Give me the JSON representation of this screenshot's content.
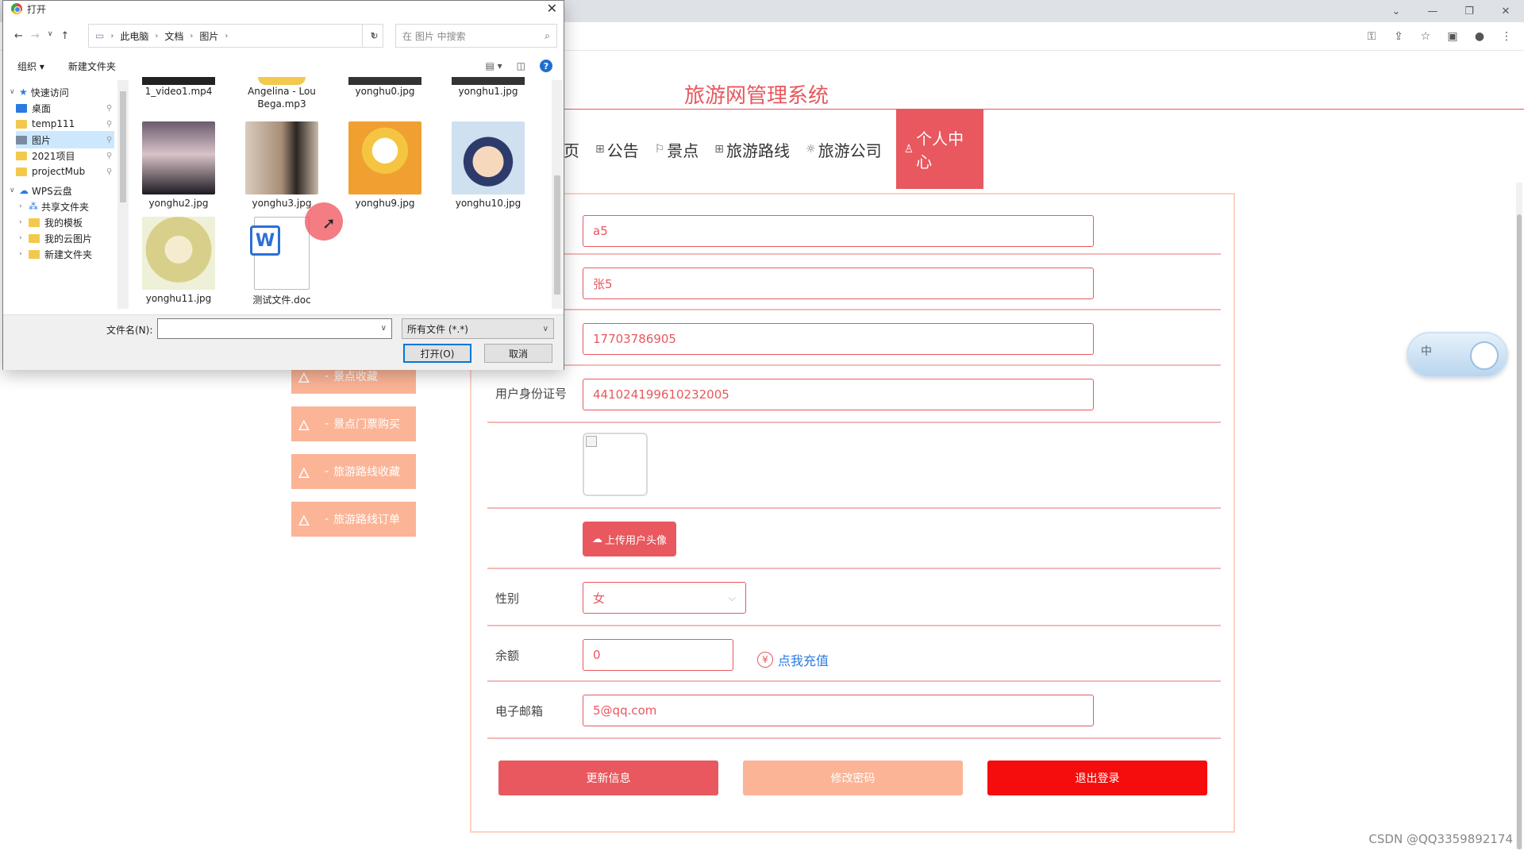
{
  "site": {
    "title": "旅游网管理系统",
    "nav": [
      {
        "icon": "",
        "label": "页"
      },
      {
        "icon": "⊞",
        "label": "公告"
      },
      {
        "icon": "⚐",
        "label": "景点"
      },
      {
        "icon": "⊞",
        "label": "旅游路线"
      },
      {
        "icon": "☼",
        "label": "旅游公司"
      },
      {
        "icon": "♙",
        "label": "个人中心"
      }
    ],
    "sidebar": [
      "景点收藏",
      "景点门票购买",
      "旅游路线收藏",
      "旅游路线订单"
    ],
    "sidebar_dash": "-"
  },
  "form": {
    "account": "a5",
    "name": "张5",
    "phone": "17703786905",
    "id_label": "用户身份证号",
    "id_number": "441024199610232005",
    "upload_label": "上传用户头像",
    "gender_label": "性别",
    "gender_value": "女",
    "balance_label": "余额",
    "balance_value": "0",
    "recharge_label": "点我充值",
    "email_label": "电子邮箱",
    "email_value": "5@qq.com",
    "btn_update": "更新信息",
    "btn_password": "修改密码",
    "btn_logout": "退出登录"
  },
  "ime": {
    "char": "中"
  },
  "watermark": "CSDN @QQ3359892174",
  "dialog": {
    "title": "打开",
    "breadcrumb": [
      "此电脑",
      "文档",
      "图片"
    ],
    "search_placeholder": "在 图片 中搜索",
    "organize": "组织 ▾",
    "new_folder": "新建文件夹",
    "tree": [
      {
        "label": "快速访问",
        "kind": "star",
        "level": 0
      },
      {
        "label": "桌面",
        "kind": "desktop",
        "level": 1
      },
      {
        "label": "temp111",
        "kind": "folder",
        "level": 1
      },
      {
        "label": "图片",
        "kind": "pictures",
        "level": 1
      },
      {
        "label": "2021项目",
        "kind": "folder",
        "level": 1
      },
      {
        "label": "projectMub",
        "kind": "folder",
        "level": 1
      },
      {
        "label": "WPS云盘",
        "kind": "cloud",
        "level": 0
      },
      {
        "label": "共享文件夹",
        "kind": "share",
        "level": 1
      },
      {
        "label": "我的模板",
        "kind": "folder",
        "level": 1
      },
      {
        "label": "我的云图片",
        "kind": "folder",
        "level": 1
      },
      {
        "label": "新建文件夹",
        "kind": "folder",
        "level": 1
      }
    ],
    "files_top": [
      "1_video1.mp4",
      "Angelina - Lou Bega.mp3",
      "yonghu0.jpg",
      "yonghu1.jpg"
    ],
    "files": [
      "yonghu2.jpg",
      "yonghu3.jpg",
      "yonghu9.jpg",
      "yonghu10.jpg",
      "yonghu11.jpg",
      "测试文件.doc"
    ],
    "filename_label": "文件名(N):",
    "filetype": "所有文件 (*.*)",
    "btn_open": "打开(O)",
    "btn_cancel": "取消"
  }
}
